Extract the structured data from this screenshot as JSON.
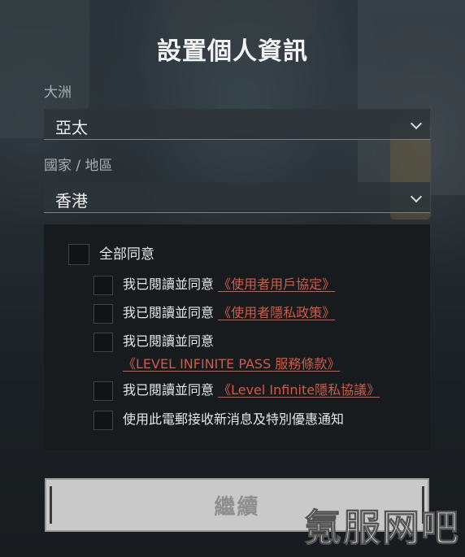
{
  "title": "設置個人資訊",
  "region": {
    "label": "大洲",
    "value": "亞太"
  },
  "country": {
    "label": "國家 / 地區",
    "value": "香港"
  },
  "agreements": {
    "all_label": "全部同意",
    "items": [
      {
        "prefix": "我已閱讀並同意",
        "link": "《使用者用戶協定》"
      },
      {
        "prefix": "我已閱讀並同意",
        "link": "《使用者隱私政策》"
      },
      {
        "prefix": "我已閱讀並同意",
        "link": "《LEVEL INFINITE PASS 服務條款》"
      },
      {
        "prefix": "我已閱讀並同意",
        "link": "《Level Infinite隱私協議》"
      },
      {
        "prefix": "使用此電郵接收新消息及特別優惠通知",
        "link": ""
      }
    ]
  },
  "continue_label": "繼續",
  "watermark": "氪服网吧",
  "colors": {
    "link": "#d05a46",
    "button_bg": "#c9c9c9"
  }
}
